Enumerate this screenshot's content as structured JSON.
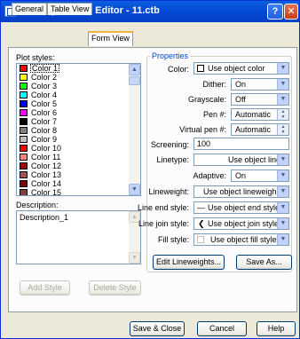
{
  "window": {
    "title": "Plot Style Table Editor - 11.ctb"
  },
  "tabs": [
    {
      "label": "General"
    },
    {
      "label": "Table View"
    },
    {
      "label": "Form View"
    }
  ],
  "plot_styles": {
    "label": "Plot styles:",
    "items": [
      {
        "name": "Color 1",
        "color": "#ff0000"
      },
      {
        "name": "Color 2",
        "color": "#ffff00"
      },
      {
        "name": "Color 3",
        "color": "#00ff00"
      },
      {
        "name": "Color 4",
        "color": "#00ffff"
      },
      {
        "name": "Color 5",
        "color": "#0000ff"
      },
      {
        "name": "Color 6",
        "color": "#ff00ff"
      },
      {
        "name": "Color 7",
        "color": "#000000"
      },
      {
        "name": "Color 8",
        "color": "#808080"
      },
      {
        "name": "Color 9",
        "color": "#c0c0c0"
      },
      {
        "name": "Color 10",
        "color": "#ff0000"
      },
      {
        "name": "Color 11",
        "color": "#ff7f7f"
      },
      {
        "name": "Color 12",
        "color": "#a50000"
      },
      {
        "name": "Color 13",
        "color": "#a55252"
      },
      {
        "name": "Color 14",
        "color": "#7f0000"
      },
      {
        "name": "Color 15",
        "color": "#7f3f3f"
      }
    ],
    "selected": "Color 1"
  },
  "description": {
    "label": "Description:",
    "value": "Description_1"
  },
  "buttons": {
    "add_style": "Add Style",
    "delete_style": "Delete Style",
    "edit_lineweights": "Edit Lineweights...",
    "save_as": "Save As...",
    "save_close": "Save & Close",
    "cancel": "Cancel",
    "help": "Help"
  },
  "properties": {
    "legend": "Properties",
    "color": {
      "label": "Color:",
      "value": "Use object color"
    },
    "dither": {
      "label": "Dither:",
      "value": "On"
    },
    "grayscale": {
      "label": "Grayscale:",
      "value": "Off"
    },
    "pen": {
      "label": "Pen #:",
      "value": "Automatic"
    },
    "virtual_pen": {
      "label": "Virtual pen #:",
      "value": "Automatic"
    },
    "screening": {
      "label": "Screening:",
      "value": "100"
    },
    "linetype": {
      "label": "Linetype:",
      "value": "Use object linety"
    },
    "adaptive": {
      "label": "Adaptive:",
      "value": "On"
    },
    "lineweight": {
      "label": "Lineweight:",
      "value": "Use object lineweigh"
    },
    "line_end": {
      "label": "Line end style:",
      "value": "Use object end style"
    },
    "line_join": {
      "label": "Line join style:",
      "value": "Use object join style"
    },
    "fill": {
      "label": "Fill style:",
      "value": "Use object fill style"
    }
  }
}
